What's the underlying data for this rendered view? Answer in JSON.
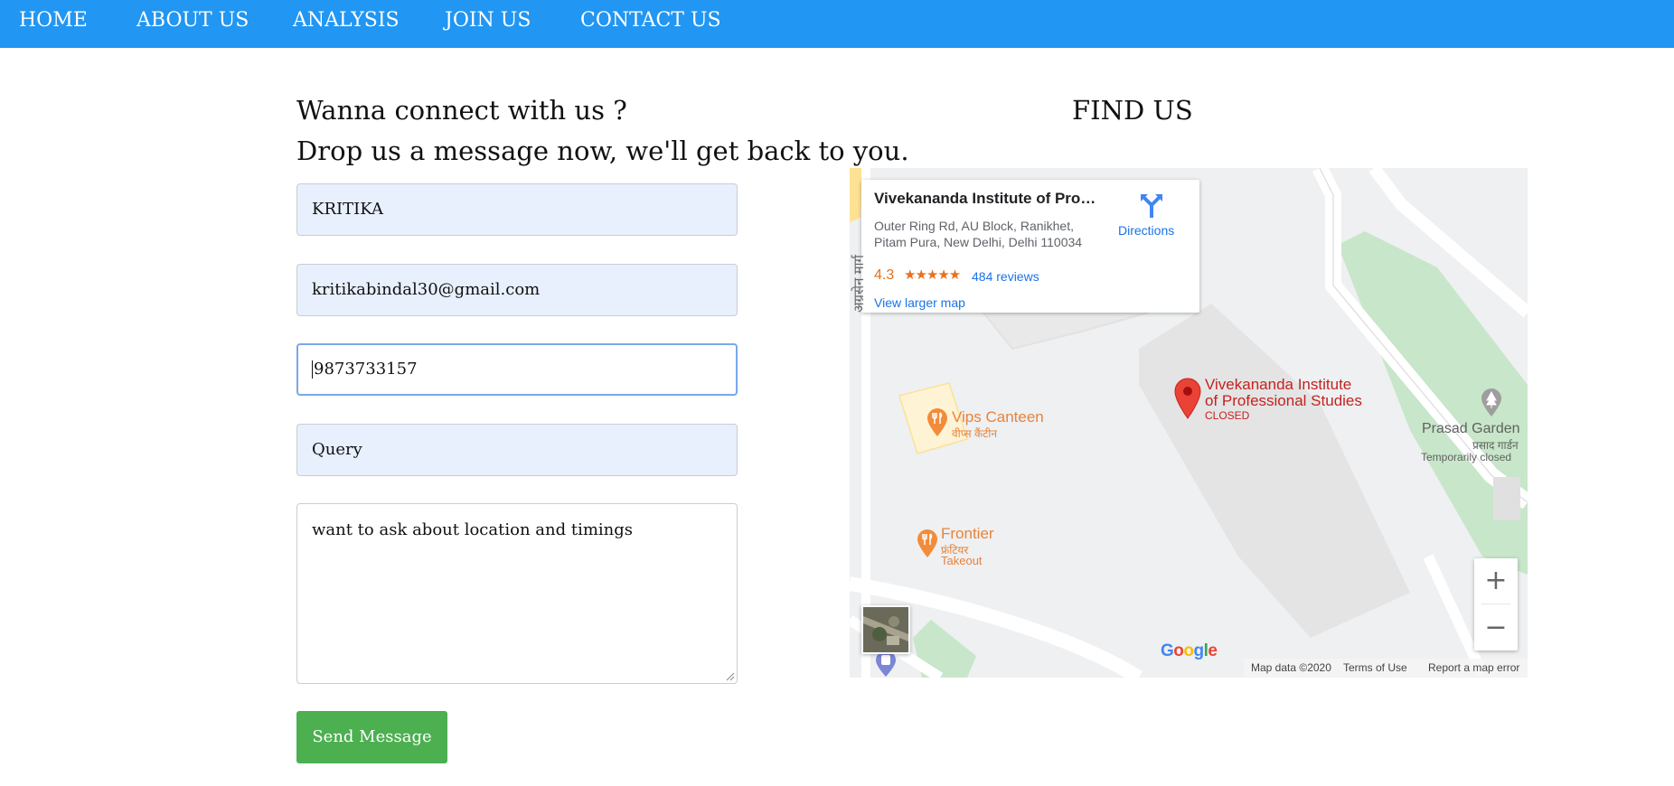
{
  "nav": {
    "items": [
      "HOME",
      "ABOUT US",
      "ANALYSIS",
      "JOIN US",
      "CONTACT US"
    ]
  },
  "contact": {
    "heading_line1": "Wanna connect with us ?",
    "heading_line2": "Drop us a message now, we'll get back to you.",
    "name_value": "KRITIKA",
    "email_value": "kritikabindal30@gmail.com",
    "phone_value": "9873733157",
    "subject_value": "Query",
    "message_value": "want to ask about location and timings",
    "send_label": "Send Message"
  },
  "find_us": {
    "heading": "FIND US"
  },
  "map": {
    "card": {
      "title": "Vivekananda Institute of Profe...",
      "address_line1": "Outer Ring Rd, AU Block, Ranikhet,",
      "address_line2": "Pitam Pura, New Delhi, Delhi 110034",
      "rating": "4.3",
      "stars": "★★★★★",
      "rating_fraction": 0.86,
      "reviews": "484 reviews",
      "view_larger": "View larger map",
      "directions": "Directions"
    },
    "place_pin": {
      "name_line1": "Vivekananda Institute",
      "name_line2": "of Professional Studies",
      "status": "CLOSED"
    },
    "pois": {
      "vips_canteen": "Vips Canteen",
      "vips_canteen_hi": "वीप्स कैंटीन",
      "frontier": "Frontier",
      "frontier_hi": "फ्रंटियर",
      "frontier_sub": "Takeout",
      "prasad_garden": "Prasad Garden",
      "prasad_garden_hi": "प्रसाद गार्डन",
      "prasad_status": "Temporarily closed",
      "road_label_hi": "अग्रसेन मार्ग"
    },
    "zoom_in": "+",
    "zoom_out": "−",
    "google": [
      "G",
      "o",
      "o",
      "g",
      "l",
      "e"
    ],
    "google_colors": [
      "#4285F4",
      "#EA4335",
      "#FBBC05",
      "#4285F4",
      "#34A853",
      "#EA4335"
    ],
    "attribution": {
      "map_data": "Map data ©2020",
      "terms": "Terms of Use",
      "report": "Report a map error"
    }
  },
  "colors": {
    "nav_bg": "#2196f3",
    "send_button": "#4caf50",
    "autofill_bg": "#e8f0fe",
    "link_blue": "#1a73e8",
    "rating_orange": "#e7711b",
    "pin_red": "#ea4335",
    "poi_orange": "#f28c3a",
    "park_green": "#c8e6c9"
  },
  "icons": {
    "directions": "directions-icon",
    "pin": "map-pin-icon",
    "restaurant": "restaurant-icon",
    "park": "park-icon",
    "transit": "transit-icon"
  }
}
